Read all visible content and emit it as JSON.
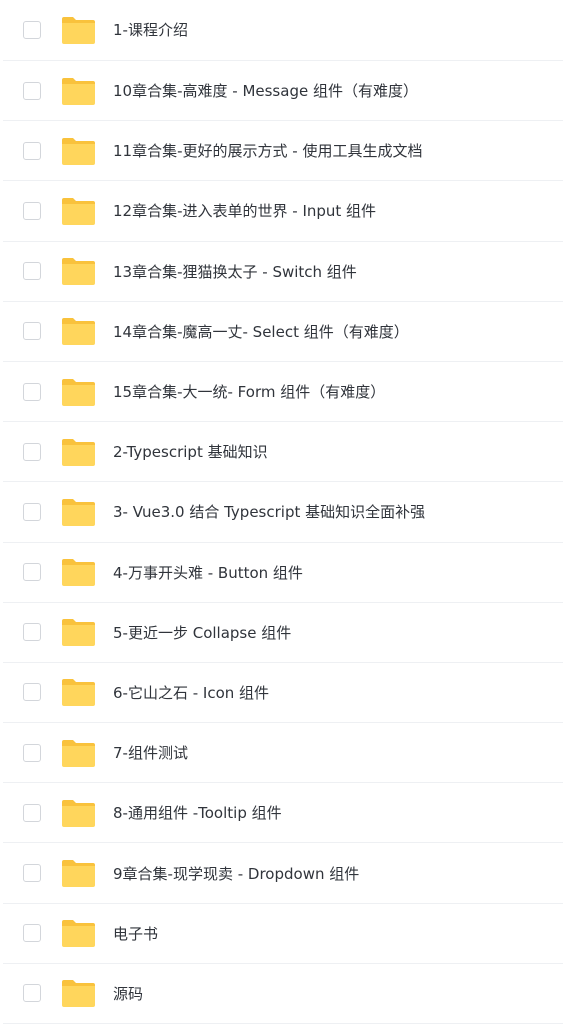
{
  "colors": {
    "folder_body": "#FFD65C",
    "folder_tab": "#F9C23C",
    "text": "#30343b",
    "divider": "#eef0f3",
    "checkbox_border": "#d3d6db"
  },
  "icons": {
    "row_icon": "folder-icon"
  },
  "items": [
    {
      "label": "1-课程介绍"
    },
    {
      "label": "10章合集-高难度 - Message 组件（有难度）"
    },
    {
      "label": "11章合集-更好的展示方式 - 使用工具生成文档"
    },
    {
      "label": "12章合集-进入表单的世界 - Input 组件"
    },
    {
      "label": "13章合集-狸猫换太子 - Switch 组件"
    },
    {
      "label": "14章合集-魔高一丈- Select 组件（有难度）"
    },
    {
      "label": "15章合集-大一统- Form 组件（有难度）"
    },
    {
      "label": "2-Typescript 基础知识"
    },
    {
      "label": "3- Vue3.0 结合 Typescript 基础知识全面补强"
    },
    {
      "label": "4-万事开头难 - Button 组件"
    },
    {
      "label": "5-更近一步 Collapse 组件"
    },
    {
      "label": "6-它山之石 - Icon 组件"
    },
    {
      "label": "7-组件测试"
    },
    {
      "label": "8-通用组件 -Tooltip 组件"
    },
    {
      "label": "9章合集-现学现卖 - Dropdown 组件"
    },
    {
      "label": "电子书"
    },
    {
      "label": "源码"
    }
  ]
}
